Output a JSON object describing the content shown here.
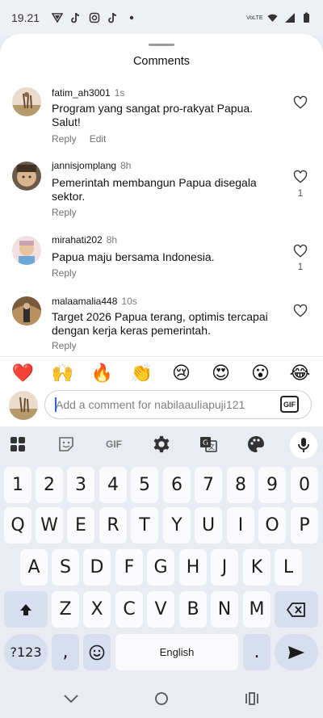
{
  "status_bar": {
    "time": "19.21",
    "network_label": "VoLTE",
    "icons": [
      "vpn-icon",
      "tiktok-icon",
      "instagram-icon",
      "tiktok-icon",
      "dot-icon",
      "wifi-icon",
      "signal-icon",
      "battery-icon"
    ]
  },
  "sheet": {
    "title": "Comments"
  },
  "comments": [
    {
      "username": "fatim_ah3001",
      "time": "1s",
      "text": "Program yang sangat pro-rakyat Papua. Salut!",
      "reply_label": "Reply",
      "edit_label": "Edit",
      "likes": ""
    },
    {
      "username": "jannisjomplang",
      "time": "8h",
      "text": "Pemerintah membangun Papua disegala sektor.",
      "reply_label": "Reply",
      "likes": "1"
    },
    {
      "username": "mirahati202",
      "time": "8h",
      "text": "Papua maju bersama Indonesia.",
      "reply_label": "Reply",
      "likes": "1"
    },
    {
      "username": "malaamalia448",
      "time": "10s",
      "text": "Target 2026 Papua terang, optimis tercapai dengan kerja keras pemerintah.",
      "reply_label": "Reply",
      "likes": ""
    }
  ],
  "emoji_bar": [
    "❤️",
    "🙌",
    "🔥",
    "👏",
    "😢",
    "😍",
    "😮",
    "😂"
  ],
  "composer": {
    "placeholder": "Add a comment for nabilaauliapuji121",
    "value": "",
    "gif_label": "GIF"
  },
  "keyboard_toolbar": {
    "items": [
      "apps-icon",
      "sticker-icon",
      "gif-icon",
      "settings-icon",
      "translate-icon",
      "palette-icon",
      "mic-icon"
    ],
    "gif_label": "GIF"
  },
  "keyboard": {
    "number_row": [
      "1",
      "2",
      "3",
      "4",
      "5",
      "6",
      "7",
      "8",
      "9",
      "0"
    ],
    "row1": [
      "Q",
      "W",
      "E",
      "R",
      "T",
      "Y",
      "U",
      "I",
      "O",
      "P"
    ],
    "row2": [
      "A",
      "S",
      "D",
      "F",
      "G",
      "H",
      "J",
      "K",
      "L"
    ],
    "row3": [
      "Z",
      "X",
      "C",
      "V",
      "B",
      "N",
      "M"
    ],
    "symbols_label": "?123",
    "comma": ",",
    "space_label": "English",
    "period": "."
  },
  "colors": {
    "accent": "#2d62e0",
    "keyboard_bg": "#e9ecf3",
    "mod_key": "#d7def0"
  }
}
